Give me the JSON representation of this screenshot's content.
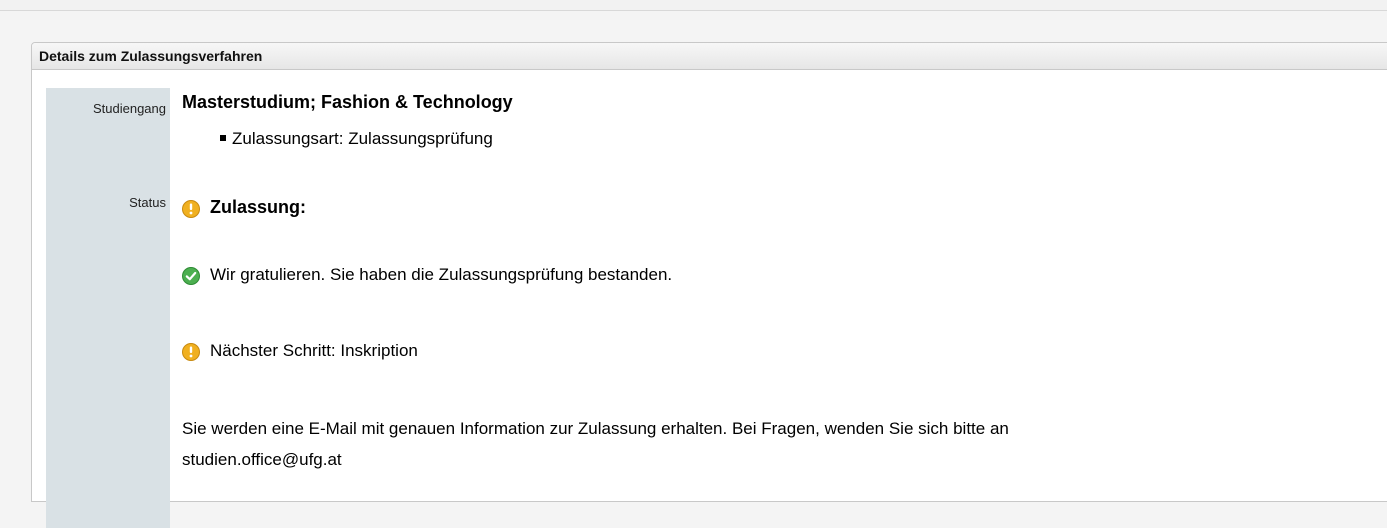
{
  "panel": {
    "title": "Details zum Zulassungsverfahren"
  },
  "labels": {
    "studiengang": "Studiengang",
    "status": "Status"
  },
  "studiengang": {
    "name": "Masterstudium; Fashion & Technology",
    "bullet": "Zulassungsart: Zulassungsprüfung"
  },
  "status": {
    "heading": "Zulassung:",
    "heading_icon": "warning-icon",
    "passed_text": "Wir gratulieren. Sie haben die Zulassungsprüfung bestanden.",
    "passed_icon": "check-icon",
    "next_step_text": "Nächster Schritt: Inskription",
    "next_step_icon": "warning-icon",
    "info_line1": "Sie werden eine E-Mail mit genauen Information zur Zulassung erhalten. Bei Fragen, wenden Sie sich bitte an",
    "info_line2": "studien.office@ufg.at"
  },
  "colors": {
    "warning": "#f0b020",
    "success": "#4caf50",
    "label_bg": "#d9e1e5"
  }
}
